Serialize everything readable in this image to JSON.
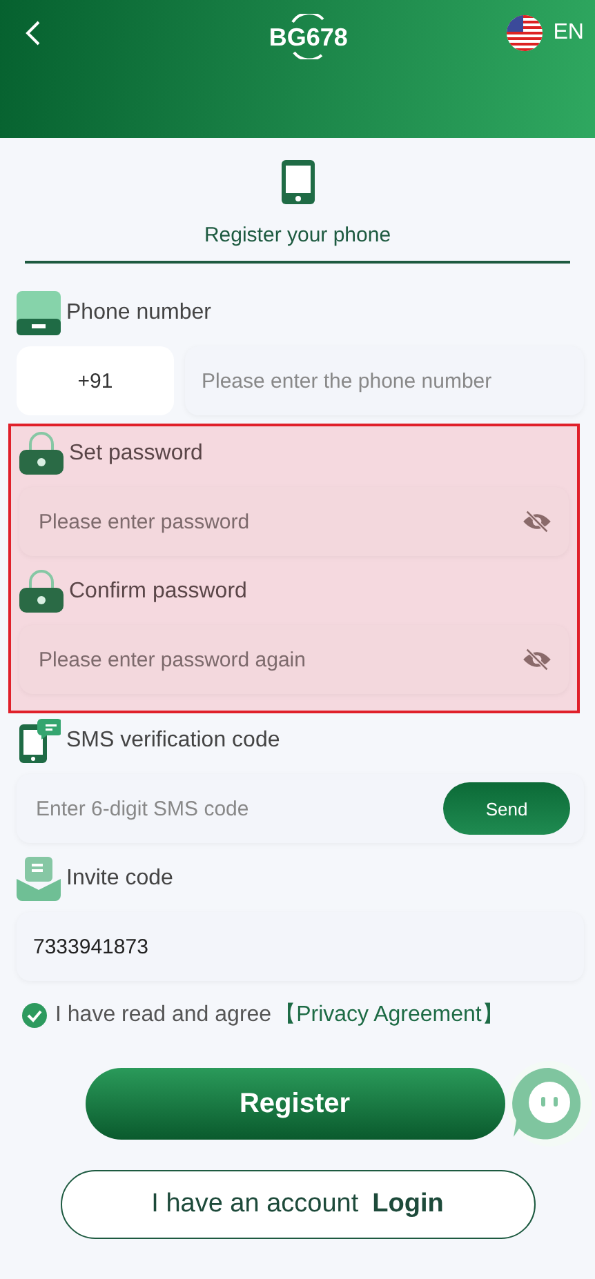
{
  "header": {
    "logo": "BG678",
    "language": "EN"
  },
  "tab": {
    "label": "Register your phone",
    "selected": true
  },
  "sections": [
    {
      "kind": "phone",
      "label": "Phone number",
      "code": "+91",
      "placeholder": "Please enter the phone number",
      "highlighted": false
    },
    {
      "kind": "password",
      "label": "Set password",
      "placeholder": "Please enter password",
      "highlighted": true
    },
    {
      "kind": "password",
      "label": "Confirm password",
      "placeholder": "Please enter password again",
      "highlighted": true
    },
    {
      "kind": "sms",
      "label": "SMS verification code",
      "placeholder": "Enter 6-digit SMS code",
      "button": "Send",
      "highlighted": false
    },
    {
      "kind": "invite",
      "label": "Invite code",
      "value": "7333941873",
      "highlighted": false
    }
  ],
  "agreement": {
    "checked": true,
    "text": "I have read and agree",
    "link": "【Privacy Agreement】"
  },
  "register_button": "Register",
  "login": {
    "text": "I have an account",
    "link": "Login"
  }
}
